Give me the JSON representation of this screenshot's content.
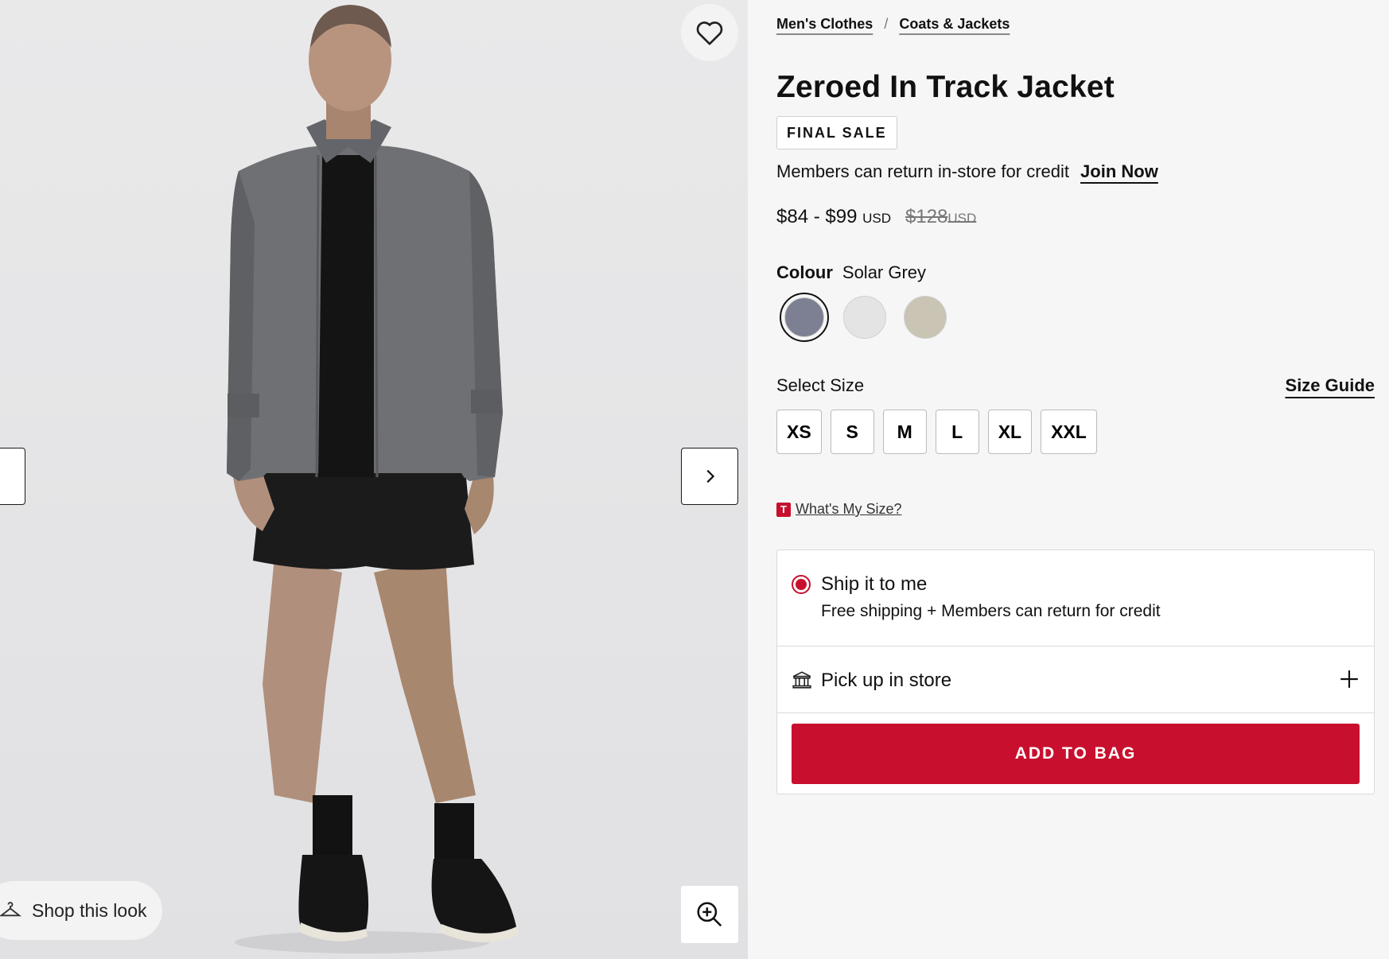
{
  "breadcrumb": {
    "items": [
      "Men's Clothes",
      "Coats & Jackets"
    ],
    "separator": "/"
  },
  "product": {
    "title": "Zeroed In Track Jacket",
    "badge": "FINAL SALE",
    "member_note": "Members can return in-store for credit",
    "join_label": "Join Now",
    "price_range": "$84 - $99",
    "price_currency": "USD",
    "original_price": "$128",
    "original_currency": "USD"
  },
  "colour": {
    "label": "Colour",
    "selected_name": "Solar Grey",
    "swatches": [
      {
        "color": "#7c8092",
        "selected": true
      },
      {
        "color": "#e4e4e4",
        "selected": false
      },
      {
        "color": "#c9c4b3",
        "selected": false
      }
    ]
  },
  "size": {
    "label": "Select Size",
    "guide_label": "Size Guide",
    "options": [
      "XS",
      "S",
      "M",
      "L",
      "XL",
      "XXL"
    ]
  },
  "whats_my_size": {
    "logo": "T",
    "label": "What's My Size?"
  },
  "fulfilment": {
    "ship_title": "Ship it to me",
    "ship_subtitle": "Free shipping + Members can return for credit",
    "pickup_title": "Pick up in store"
  },
  "cta": {
    "add_to_bag": "ADD TO BAG"
  },
  "gallery": {
    "shop_look_label": "Shop this look"
  },
  "colors": {
    "accent": "#c8102e",
    "background": "#f6f6f6"
  },
  "icons": [
    "heart-icon",
    "chevron-left-icon",
    "chevron-right-icon",
    "hanger-icon",
    "zoom-in-icon",
    "store-icon",
    "plus-icon"
  ]
}
